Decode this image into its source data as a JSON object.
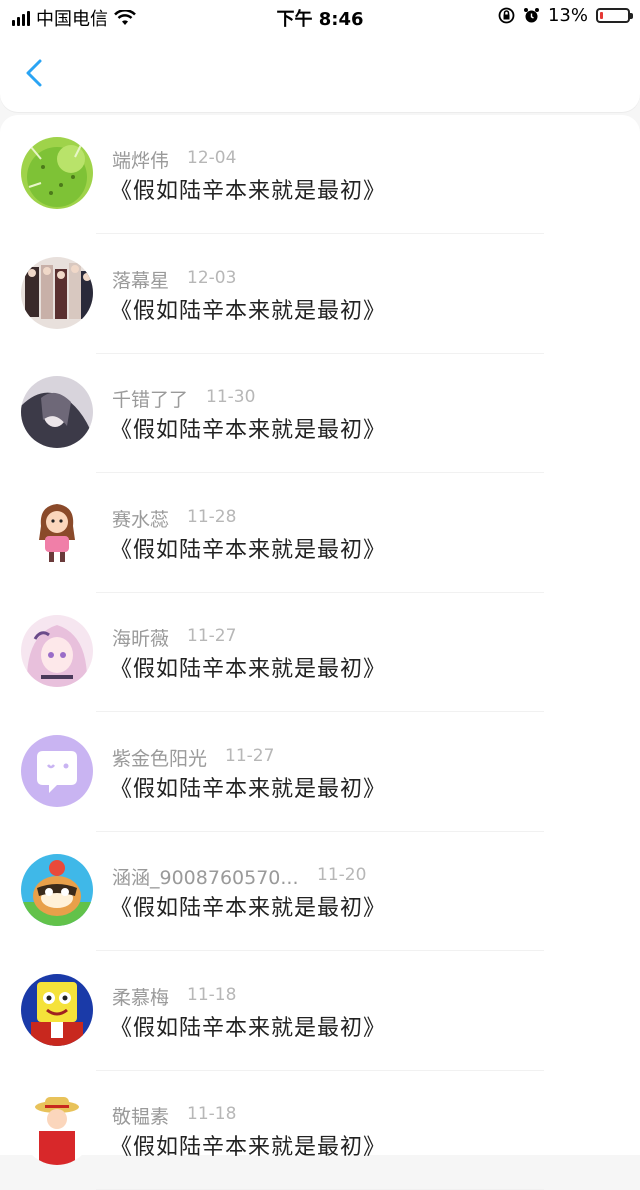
{
  "status_bar": {
    "carrier": "中国电信",
    "time": "下午 8:46",
    "battery_percent": "13%",
    "battery_level": 0.13
  },
  "header": {
    "back_icon": "chevron-left-icon",
    "accent_color": "#2aa4f4"
  },
  "messages": [
    {
      "name": "端烨伟",
      "date": "12-04",
      "text": "《假如陆辛本来就是最初》",
      "avatar": "cactus"
    },
    {
      "name": "落幕星",
      "date": "12-03",
      "text": "《假如陆辛本来就是最初》",
      "avatar": "group-photo"
    },
    {
      "name": "千错了了",
      "date": "11-30",
      "text": "《假如陆辛本来就是最初》",
      "avatar": "dark-anime"
    },
    {
      "name": "赛水蕊",
      "date": "11-28",
      "text": "《假如陆辛本来就是最初》",
      "avatar": "cartoon-girl"
    },
    {
      "name": "海昕薇",
      "date": "11-27",
      "text": "《假如陆辛本来就是最初》",
      "avatar": "pink-anime"
    },
    {
      "name": "紫金色阳光",
      "date": "11-27",
      "text": "《假如陆辛本来就是最初》",
      "avatar": "chat-bubble"
    },
    {
      "name": "涵涵_9008760570...",
      "date": "11-20",
      "text": "《假如陆辛本来就是最初》",
      "avatar": "raccoon"
    },
    {
      "name": "柔慕梅",
      "date": "11-18",
      "text": "《假如陆辛本来就是最初》",
      "avatar": "sponge"
    },
    {
      "name": "敬韫素",
      "date": "11-18",
      "text": "《假如陆辛本来就是最初》",
      "avatar": "straw-hat"
    }
  ]
}
